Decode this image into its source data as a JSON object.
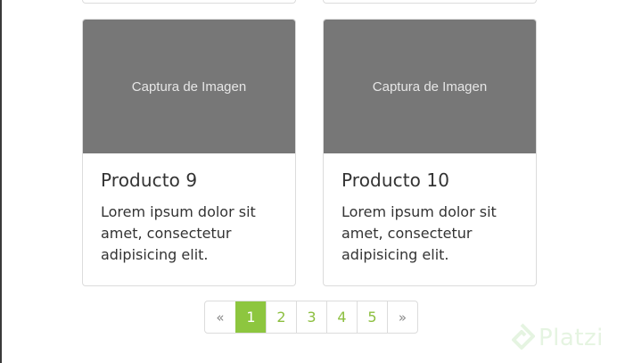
{
  "products": [
    {
      "image_label": "Captura de Imagen",
      "title": "Producto 9",
      "description": "Lorem ipsum dolor sit amet, consectetur adipisicing elit."
    },
    {
      "image_label": "Captura de Imagen",
      "title": "Producto 10",
      "description": "Lorem ipsum dolor sit amet, consectetur adipisicing elit."
    }
  ],
  "pagination": {
    "prev": "«",
    "pages": [
      "1",
      "2",
      "3",
      "4",
      "5"
    ],
    "active": "1",
    "next": "»"
  },
  "watermark": {
    "text": "Platzi"
  },
  "colors": {
    "accent": "#8dc63f",
    "image_placeholder": "#777777"
  }
}
